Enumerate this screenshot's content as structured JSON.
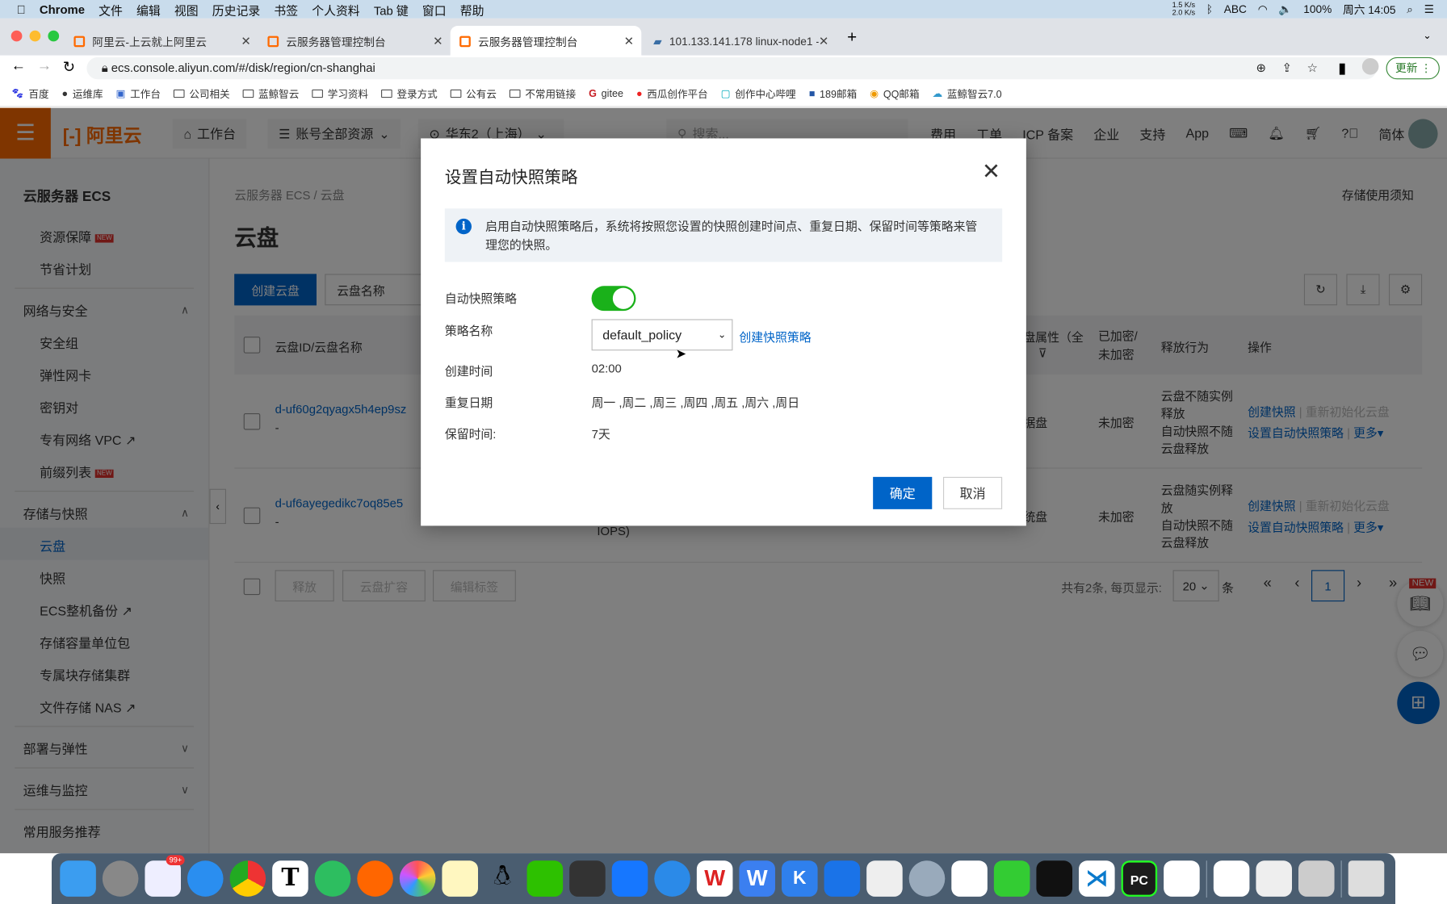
{
  "menubar": {
    "app": "Chrome",
    "items": [
      "文件",
      "编辑",
      "视图",
      "历史记录",
      "书签",
      "个人资料",
      "Tab 键",
      "窗口",
      "帮助"
    ],
    "net_up": "1.5 K/s",
    "net_down": "2.0 K/s",
    "input": "ABC",
    "battery": "100%",
    "clock": "周六 14:05"
  },
  "browser": {
    "tabs": [
      {
        "title": "阿里云-上云就上阿里云"
      },
      {
        "title": "云服务器管理控制台"
      },
      {
        "title": "云服务器管理控制台",
        "active": true
      },
      {
        "title": "101.133.141.178 linux-node1 - "
      }
    ],
    "url": "ecs.console.aliyun.com/#/disk/region/cn-shanghai",
    "update_label": "更新",
    "bookmarks": [
      "百度",
      "运维库",
      "工作台",
      "公司相关",
      "蓝鲸智云",
      "学习资料",
      "登录方式",
      "公有云",
      "不常用链接",
      "gitee",
      "西瓜创作平台",
      "创作中心哔哩",
      "189邮箱",
      "QQ邮箱",
      "蓝鲸智云7.0"
    ]
  },
  "header": {
    "logo": "阿里云",
    "workbench": "工作台",
    "resources": "账号全部资源",
    "region": "华东2（上海）",
    "search_placeholder": "搜索...",
    "links": [
      "费用",
      "工单",
      "ICP 备案",
      "企业",
      "支持",
      "App"
    ],
    "lang": "简体"
  },
  "sidebar": {
    "title": "云服务器 ECS",
    "items_top": [
      {
        "label": "资源保障",
        "badge": "NEW"
      },
      {
        "label": "节省计划"
      }
    ],
    "group_network": "网络与安全",
    "network_items": [
      {
        "label": "安全组"
      },
      {
        "label": "弹性网卡"
      },
      {
        "label": "密钥对"
      },
      {
        "label": "专有网络 VPC"
      },
      {
        "label": "前缀列表",
        "badge": "NEW"
      }
    ],
    "group_storage": "存储与快照",
    "storage_items": [
      {
        "label": "云盘",
        "active": true
      },
      {
        "label": "快照"
      },
      {
        "label": "ECS整机备份"
      },
      {
        "label": "存储容量单位包"
      },
      {
        "label": "专属块存储集群"
      },
      {
        "label": "文件存储 NAS"
      }
    ],
    "groups_bottom": [
      "部署与弹性",
      "运维与监控",
      "常用服务推荐"
    ]
  },
  "main": {
    "breadcrumb": [
      "云服务器 ECS",
      "云盘"
    ],
    "title": "云盘",
    "notice": "存储使用须知",
    "create_button": "创建云盘",
    "filter_select": "云盘名称",
    "columns": [
      "云盘ID/云盘名称",
      "盘属性（全",
      "已加密/未加密",
      "释放行为",
      "操作"
    ],
    "rows": [
      {
        "id": "d-uf60g2qyagx5h4ep9sz",
        "name": "-",
        "type": "据盘",
        "enc": "未加密",
        "release": [
          "云盘不随实例释放",
          "自动快照不随云盘释放"
        ],
        "actions": [
          "创建快照",
          "重新初始化云盘",
          "设置自动快照策略",
          "更多"
        ]
      },
      {
        "id": "d-uf6ayegedikc7oq85e5",
        "name": "-",
        "type": "统盘",
        "extra": "IOPS)",
        "enc": "未加密",
        "release": [
          "云盘随实例释放",
          "自动快照不随云盘释放"
        ],
        "actions": [
          "创建快照",
          "重新初始化云盘",
          "设置自动快照策略",
          "更多"
        ]
      }
    ],
    "batch": [
      "释放",
      "云盘扩容",
      "编辑标签"
    ],
    "pagination": {
      "summary": "共有2条, 每页显示:",
      "page_size": "20",
      "unit": "条",
      "current": "1"
    },
    "new_badge": "NEW"
  },
  "modal": {
    "title": "设置自动快照策略",
    "info": "启用自动快照策略后，系统将按照您设置的快照创建时间点、重复日期、保留时间等策略来管理您的快照。",
    "fields": {
      "enable_label": "自动快照策略",
      "enabled": true,
      "policy_label": "策略名称",
      "policy_value": "default_policy",
      "create_policy_link": "创建快照策略",
      "time_label": "创建时间",
      "time_value": "02:00",
      "repeat_label": "重复日期",
      "repeat_value": "周一 ,周二 ,周三 ,周四 ,周五 ,周六 ,周日",
      "retain_label": "保留时间:",
      "retain_value": "7天"
    },
    "ok": "确定",
    "cancel": "取消"
  },
  "colors": {
    "brand": "#ff6a00",
    "primary": "#0064c8",
    "toggle_on": "#1ab11a"
  },
  "dock_badge": "99+"
}
